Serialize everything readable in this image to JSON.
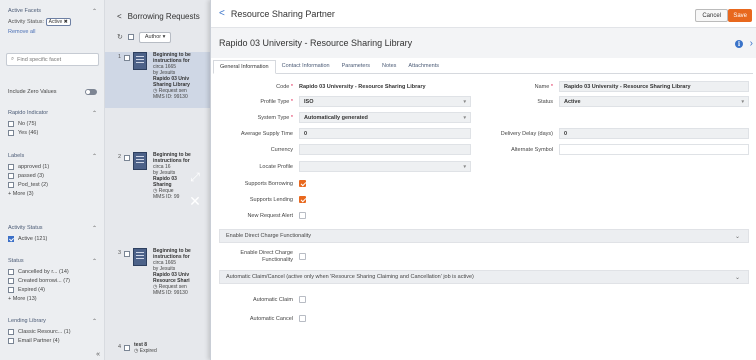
{
  "facets": {
    "active_facets_label": "Active Facets",
    "active_filter_label": "Activity Status:",
    "active_filter_value": "Active",
    "remove_all": "Remove all",
    "find_placeholder": "Find specific facet",
    "zero_values_label": "Include Zero Values",
    "rapido_indicator": {
      "title": "Rapido Indicator",
      "items": [
        {
          "label": "No (75)"
        },
        {
          "label": "Yes (46)"
        }
      ]
    },
    "labels": {
      "title": "Labels",
      "items": [
        {
          "label": "approved (1)"
        },
        {
          "label": "passed (3)"
        },
        {
          "label": "Pod_test (2)"
        }
      ],
      "more": "+ More (3)"
    },
    "activity_status": {
      "title": "Activity Status",
      "items": [
        {
          "label": "Active (121)"
        }
      ]
    },
    "status": {
      "title": "Status",
      "items": [
        {
          "label": "Cancelled by r... (14)"
        },
        {
          "label": "Created borrowi... (7)"
        },
        {
          "label": "Expired (4)"
        }
      ],
      "more": "+ More (13)"
    },
    "lending_library": {
      "title": "Lending Library",
      "items": [
        {
          "label": "Classic Resourc... (1)"
        },
        {
          "label": "Email Partner (4)"
        }
      ]
    }
  },
  "results": {
    "title": "Borrowing Requests",
    "author_btn": "Author",
    "items": [
      {
        "num": "1",
        "lines": [
          "Beginning to be",
          "instructions for",
          "circa 1665",
          "by Jesuits",
          "Rapido 03 Univ",
          "Sharing Library",
          "Request sen",
          "MMS ID: 99130"
        ]
      },
      {
        "num": "2",
        "lines": [
          "Beginning to be",
          "instructions for",
          "circa 16",
          "by Jesuits",
          "Rapido 03",
          "Sharing",
          "Reque",
          "MMS ID: 99"
        ]
      },
      {
        "num": "3",
        "lines": [
          "Beginning to be",
          "instructions for",
          "circa 1665",
          "by Jesuits",
          "Rapido 03 Univ",
          "Resource Shari",
          "Request sen",
          "MMS ID: 99130"
        ]
      },
      {
        "num": "4",
        "lines": [
          "test 8",
          "Expired"
        ]
      }
    ]
  },
  "detail": {
    "window_title": "Resource Sharing Partner",
    "cancel": "Cancel",
    "save": "Save",
    "partner_name": "Rapido 03 University - Resource Sharing Library",
    "tabs": [
      "General Information",
      "Contact Information",
      "Parameters",
      "Notes",
      "Attachments"
    ],
    "fields": {
      "code_label": "Code",
      "code_value": "Rapido 03 University - Resource Sharing Library",
      "name_label": "Name",
      "name_value": "Rapido 03 University - Resource Sharing Library",
      "profile_type_label": "Profile Type",
      "profile_type_value": "ISO",
      "status_label": "Status",
      "status_value": "Active",
      "system_type_label": "System Type",
      "system_type_value": "Automatically generated",
      "avg_supply_label": "Average Supply Time",
      "avg_supply_value": "0",
      "delivery_delay_label": "Delivery Delay (days)",
      "delivery_delay_value": "0",
      "currency_label": "Currency",
      "currency_value": "",
      "alt_symbol_label": "Alternate Symbol",
      "alt_symbol_value": "",
      "locate_profile_label": "Locate Profile",
      "locate_profile_value": "",
      "supports_borrowing_label": "Supports Borrowing",
      "supports_lending_label": "Supports Lending",
      "new_request_alert_label": "New Request Alert"
    },
    "checkbox_state": {
      "supports_borrowing": true,
      "supports_lending": true,
      "new_request_alert": false,
      "enable_direct_charge": false,
      "automatic_claim": false,
      "automatic_cancel": false
    },
    "section_direct_charge": "Enable Direct Charge Functionality",
    "enable_direct_charge_label": "Enable Direct Charge Functionality",
    "section_auto_claim": "Automatic Claim/Cancel (active only when 'Resource Sharing Claiming and Cancellation' job is active)",
    "automatic_claim_label": "Automatic Claim",
    "automatic_cancel_label": "Automatic Cancel"
  },
  "colors": {
    "accent": "#e8681e",
    "link": "#3a73c9",
    "checkbox_facet": "#3b6fc7"
  }
}
